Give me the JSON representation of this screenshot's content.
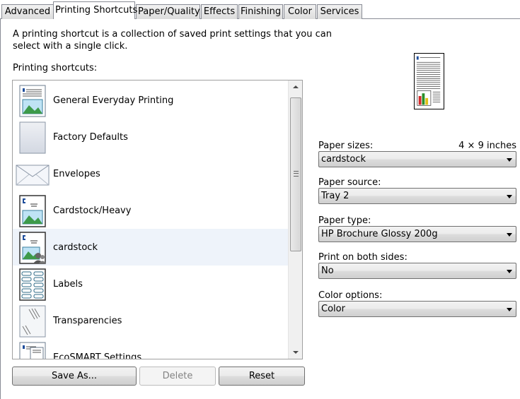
{
  "tabs": [
    {
      "label": "Advanced"
    },
    {
      "label": "Printing Shortcuts"
    },
    {
      "label": "Paper/Quality"
    },
    {
      "label": "Effects"
    },
    {
      "label": "Finishing"
    },
    {
      "label": "Color"
    },
    {
      "label": "Services"
    }
  ],
  "description": "A printing shortcut is a collection of saved print settings that you can select with a single click.",
  "list_label": "Printing shortcuts:",
  "shortcuts": [
    {
      "label": "General Everyday Printing",
      "icon": "general-everyday-icon"
    },
    {
      "label": "Factory Defaults",
      "icon": "factory-defaults-icon"
    },
    {
      "label": "Envelopes",
      "icon": "envelope-icon"
    },
    {
      "label": "Cardstock/Heavy",
      "icon": "cardstock-heavy-icon"
    },
    {
      "label": "cardstock",
      "icon": "cardstock-user-icon",
      "selected": true
    },
    {
      "label": "Labels",
      "icon": "labels-icon"
    },
    {
      "label": "Transparencies",
      "icon": "transparencies-icon"
    },
    {
      "label": "EcoSMART Settings",
      "icon": "ecosmart-icon"
    }
  ],
  "buttons": {
    "save_as": "Save As...",
    "delete": "Delete",
    "reset": "Reset"
  },
  "fields": {
    "paper_sizes": {
      "label": "Paper sizes:",
      "dimension": "4 × 9 inches",
      "value": "cardstock"
    },
    "paper_source": {
      "label": "Paper source:",
      "value": "Tray 2"
    },
    "paper_type": {
      "label": "Paper type:",
      "value": "HP Brochure Glossy 200g"
    },
    "both_sides": {
      "label": "Print on both sides:",
      "value": "No"
    },
    "color_options": {
      "label": "Color options:",
      "value": "Color"
    }
  }
}
